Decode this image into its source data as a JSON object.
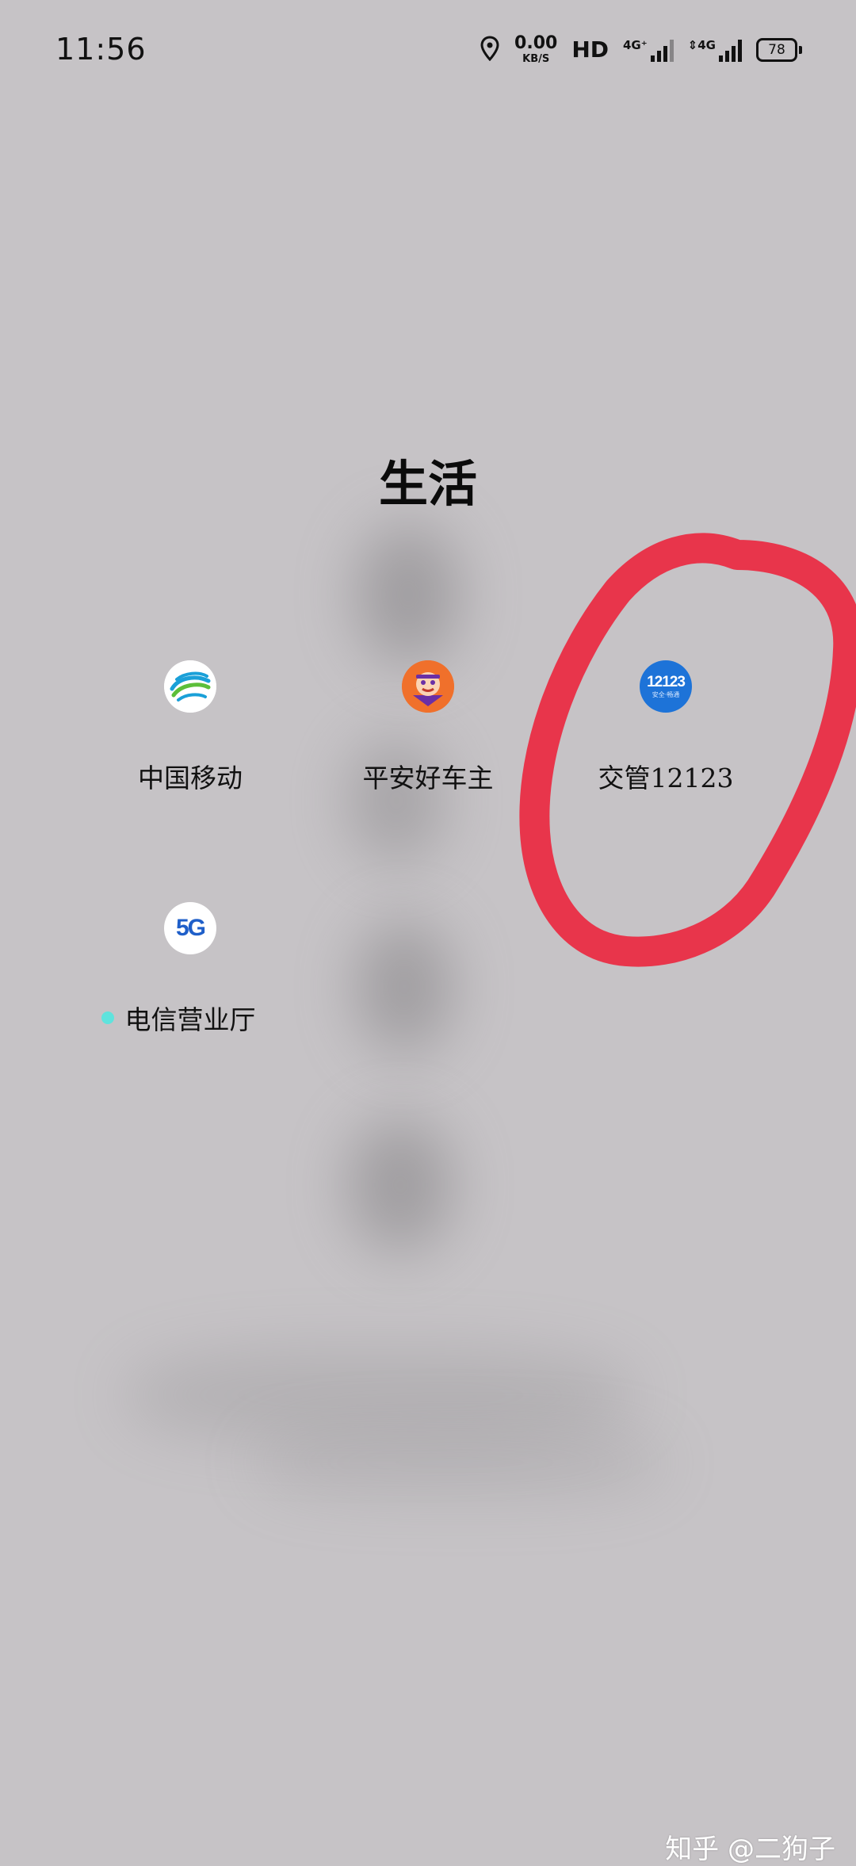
{
  "status_bar": {
    "time": "11:56",
    "net_speed_value": "0.00",
    "net_speed_unit": "KB/S",
    "hd": "HD",
    "sim1_label": "4G⁺",
    "sim2_label": "⇕4G",
    "battery": "78",
    "icons": [
      "location-icon",
      "signal-icon",
      "battery-icon"
    ]
  },
  "folder": {
    "title": "生活",
    "apps": [
      {
        "label": "中国移动",
        "icon": "china-mobile-icon"
      },
      {
        "label": "平安好车主",
        "icon": "pingan-car-owner-icon"
      },
      {
        "label": "交管12123",
        "icon": "traffic-12123-icon",
        "icon_text": "12123",
        "icon_subtext": "安全·畅通"
      },
      {
        "label": "电信营业厅",
        "icon": "telecom-5g-icon",
        "icon_text": "5G",
        "has_new_dot": true
      }
    ]
  },
  "annotation": {
    "color": "#e8354b",
    "target": "交管12123"
  },
  "watermark": "知乎 @二狗子",
  "colors": {
    "background": "#c6c3c6",
    "new_dot": "#5fe3dd",
    "traffic_icon_blue": "#1d73d8"
  }
}
